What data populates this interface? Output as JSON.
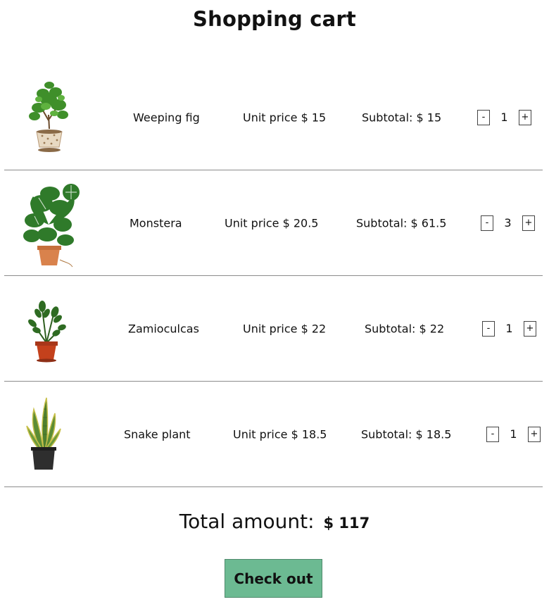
{
  "page": {
    "title": "Shopping cart"
  },
  "cart": {
    "items": [
      {
        "image_icon": "weeping-fig-plant",
        "name": "Weeping fig",
        "unit_price_label": "Unit price $ 15",
        "subtotal_label": "Subtotal: $ 15",
        "quantity": "1",
        "decrement_label": "-",
        "increment_label": "+"
      },
      {
        "image_icon": "monstera-plant",
        "name": "Monstera",
        "unit_price_label": "Unit price $ 20.5",
        "subtotal_label": "Subtotal: $ 61.5",
        "quantity": "3",
        "decrement_label": "-",
        "increment_label": "+"
      },
      {
        "image_icon": "zamioculcas-plant",
        "name": "Zamioculcas",
        "unit_price_label": "Unit price $ 22",
        "subtotal_label": "Subtotal: $ 22",
        "quantity": "1",
        "decrement_label": "-",
        "increment_label": "+"
      },
      {
        "image_icon": "snake-plant",
        "name": "Snake plant",
        "unit_price_label": "Unit price $ 18.5",
        "subtotal_label": "Subtotal: $ 18.5",
        "quantity": "1",
        "decrement_label": "-",
        "increment_label": "+"
      }
    ]
  },
  "summary": {
    "total_label": "Total amount:",
    "total_amount": "$ 117"
  },
  "actions": {
    "checkout_label": "Check out"
  },
  "colors": {
    "checkout_bg": "#6cba92",
    "divider": "#8c8c8c"
  }
}
